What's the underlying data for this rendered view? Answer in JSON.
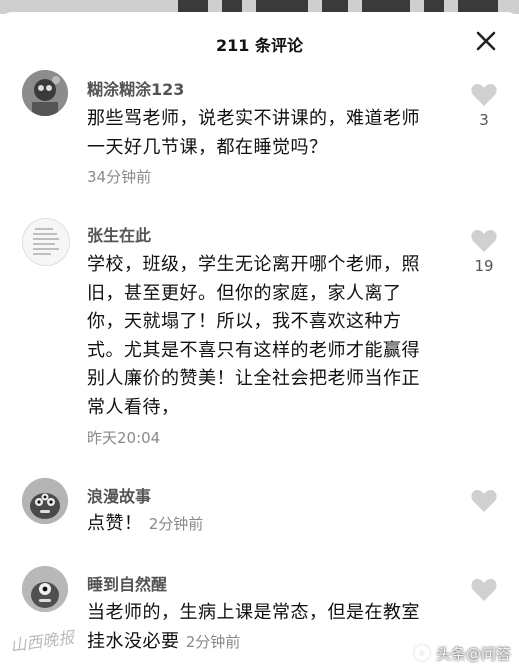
{
  "header": {
    "title": "211 条评论"
  },
  "comments": [
    {
      "username": "糊涂糊涂123",
      "text": "那些骂老师，说老实不讲课的，难道老师一天好几节课，都在睡觉吗？",
      "time": "34分钟前",
      "likes": "3",
      "avatar_icon": "cartoon-avatar"
    },
    {
      "username": "张生在此",
      "text": "学校，班级，学生无论离开哪个老师，照旧，甚至更好。但你的家庭，家人离了你，天就塌了！所以，我不喜欢这种方式。尤其是不喜只有这样的老师才能赢得别人廉价的赞美！让全社会把老师当作正常人看待，",
      "time": "昨天20:04",
      "likes": "19",
      "avatar_icon": "text-document-avatar"
    },
    {
      "username": "浪漫故事",
      "text": "点赞！",
      "time": "2分钟前",
      "likes": "",
      "avatar_icon": "monster-avatar"
    },
    {
      "username": "睡到自然醒",
      "text": "当老师的，生病上课是常态，但是在教室挂水没必要",
      "time": "2分钟前",
      "likes": "",
      "avatar_icon": "monster-avatar"
    }
  ],
  "watermark": {
    "left_text": "山西晚报",
    "right_text": "头条@问答"
  },
  "icons": {
    "close": "close-icon",
    "like": "heart-icon"
  }
}
